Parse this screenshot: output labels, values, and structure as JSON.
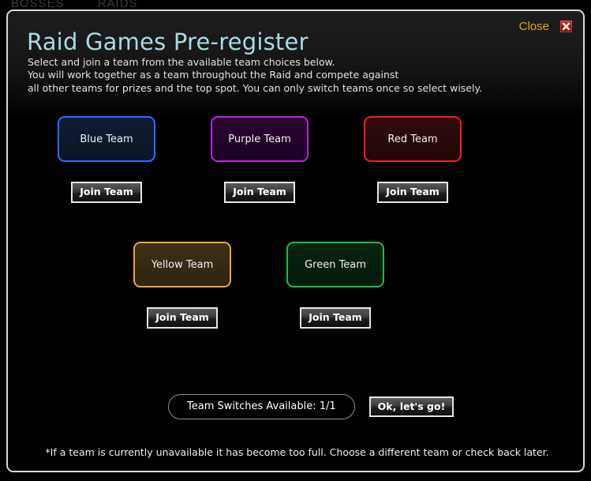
{
  "background_nav": {
    "items": [
      "BOSSES",
      "RAIDS"
    ]
  },
  "modal": {
    "title": "Raid Games Pre-register",
    "close": {
      "label": "Close",
      "icon": "close-x-icon"
    },
    "description": [
      "Select and join a team from the available team choices below.",
      "You will work together as a team throughout the Raid and compete against",
      "all other teams for prizes and the top spot. You can only switch teams once so select wisely."
    ],
    "teams": {
      "row_1": [
        {
          "name": "Blue Team",
          "color": "#2f6bff",
          "fill": "#0f1b33",
          "join_label": "Join Team"
        },
        {
          "name": "Purple Team",
          "color": "#c020e0",
          "fill": "#2a0430",
          "join_label": "Join Team"
        },
        {
          "name": "Red Team",
          "color": "#ec2020",
          "fill": "#300b0b",
          "join_label": "Join Team"
        }
      ],
      "row_2": [
        {
          "name": "Yellow Team",
          "color": "#e8a830",
          "fill": "#3d3016",
          "join_label": "Join Team"
        },
        {
          "name": "Green Team",
          "color": "#10c050",
          "fill": "#06240f",
          "join_label": "Join Team"
        }
      ]
    },
    "footer": {
      "switches_label": "Team Switches Available: 1/1",
      "switches_available": 1,
      "switches_total": 1,
      "confirm_label": "Ok, let's go!"
    },
    "note": "*If a team is currently unavailable it has become too full. Choose a different team or check back later."
  },
  "colors": {
    "title": "#a9dae6",
    "close_label": "#e8a317",
    "modal_border": "#d8d8d8",
    "page_background": "#000000"
  }
}
